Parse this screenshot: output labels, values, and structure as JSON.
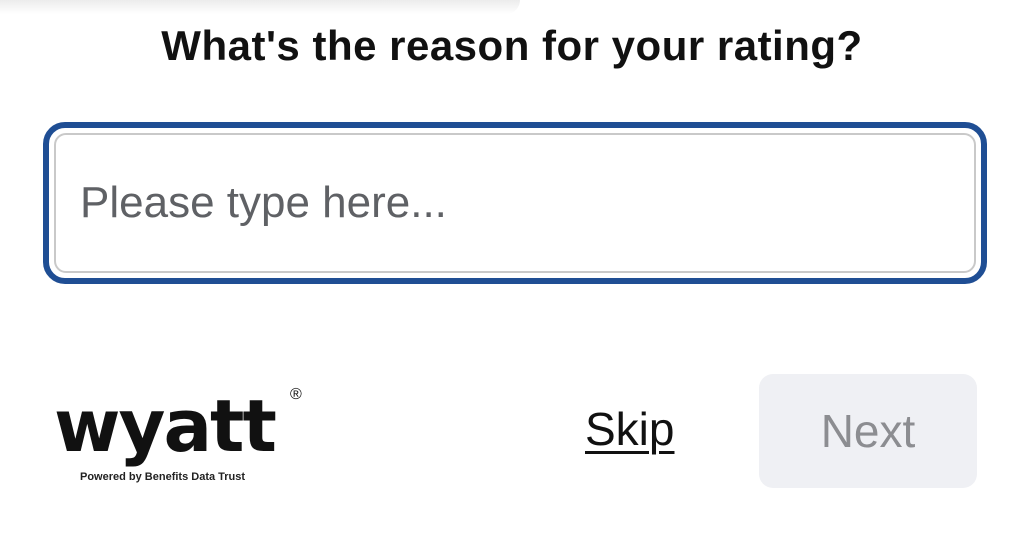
{
  "prompt": {
    "question": "What's the reason for your rating?"
  },
  "reason_input": {
    "placeholder": "Please type here...",
    "value": ""
  },
  "branding": {
    "logo_text": "wyatt",
    "registered_mark": "®",
    "tagline": "Powered by Benefits Data Trust"
  },
  "actions": {
    "skip_label": "Skip",
    "next_label": "Next",
    "next_enabled": false
  },
  "colors": {
    "input_focus_border": "#1f4e94",
    "next_disabled_bg": "#eff0f4",
    "next_disabled_text": "#8c8d91",
    "text": "#111111"
  }
}
